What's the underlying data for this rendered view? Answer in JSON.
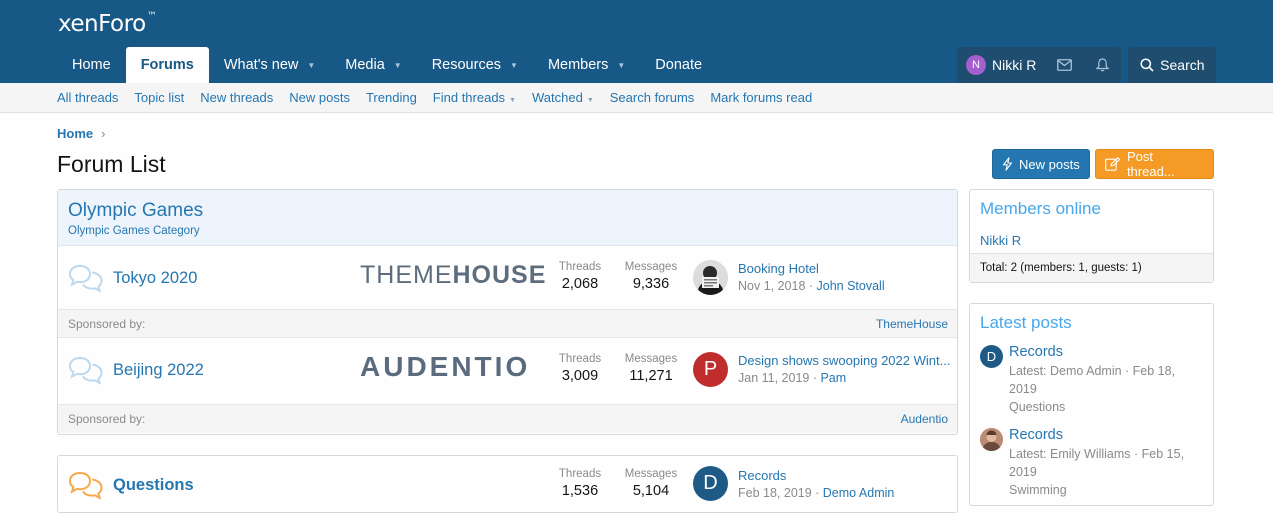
{
  "header": {
    "logo": "xenForo",
    "logo_mark": "™",
    "nav": [
      {
        "label": "Home",
        "caret": false
      },
      {
        "label": "Forums",
        "caret": false,
        "active": true
      },
      {
        "label": "What's new",
        "caret": true
      },
      {
        "label": "Media",
        "caret": true
      },
      {
        "label": "Resources",
        "caret": true
      },
      {
        "label": "Members",
        "caret": true
      },
      {
        "label": "Donate",
        "caret": false
      }
    ],
    "user": {
      "initial": "N",
      "name": "Nikki R"
    },
    "search_label": "Search"
  },
  "subnav": [
    {
      "label": "All threads"
    },
    {
      "label": "Topic list"
    },
    {
      "label": "New threads"
    },
    {
      "label": "New posts"
    },
    {
      "label": "Trending"
    },
    {
      "label": "Find threads",
      "caret": true
    },
    {
      "label": "Watched",
      "caret": true
    },
    {
      "label": "Search forums"
    },
    {
      "label": "Mark forums read"
    }
  ],
  "breadcrumb": {
    "home": "Home",
    "sep": "›"
  },
  "page_title": "Forum List",
  "buttons": {
    "new_posts": "New posts",
    "post_thread": "Post thread..."
  },
  "category": {
    "title": "Olympic Games",
    "description": "Olympic Games Category"
  },
  "forums": [
    {
      "title": "Tokyo 2020",
      "sponsor_logo_light": "THEME",
      "sponsor_logo_bold": "HOUSE",
      "threads_label": "Threads",
      "threads": "2,068",
      "messages_label": "Messages",
      "messages": "9,336",
      "last_title": "Booking Hotel",
      "last_date": "Nov 1, 2018 · ",
      "last_user": "John Stovall",
      "sponsored_label": "Sponsored by:",
      "sponsor_link": "ThemeHouse"
    },
    {
      "title": "Beijing 2022",
      "sponsor_logo": "AUDENTIO",
      "threads_label": "Threads",
      "threads": "3,009",
      "messages_label": "Messages",
      "messages": "11,271",
      "avatar_initial": "P",
      "last_title": "Design shows swooping 2022 Wint...",
      "last_date": "Jan 11, 2019 · ",
      "last_user": "Pam",
      "sponsored_label": "Sponsored by:",
      "sponsor_link": "Audentio"
    },
    {
      "title": "Questions",
      "threads_label": "Threads",
      "threads": "1,536",
      "messages_label": "Messages",
      "messages": "5,104",
      "avatar_initial": "D",
      "last_title": "Records",
      "last_date": "Feb 18, 2019 · ",
      "last_user": "Demo Admin"
    }
  ],
  "sidebar": {
    "members_online": {
      "title": "Members online",
      "users": [
        "Nikki R"
      ],
      "footer": "Total: 2 (members: 1, guests: 1)"
    },
    "latest_posts": {
      "title": "Latest posts",
      "items": [
        {
          "avatar_initial": "D",
          "title": "Records",
          "meta_line1": "Latest: Demo Admin · Feb 18,",
          "meta_line2": "2019",
          "forum": "Questions"
        },
        {
          "title": "Records",
          "meta_line1": "Latest: Emily Williams · Feb 15,",
          "meta_line2": "2019",
          "forum": "Swimming"
        }
      ]
    }
  },
  "colors": {
    "header_bg": "#185886",
    "link": "#2577b1",
    "accent_orange": "#f59b25",
    "sidebar_title": "#47a7eb"
  }
}
